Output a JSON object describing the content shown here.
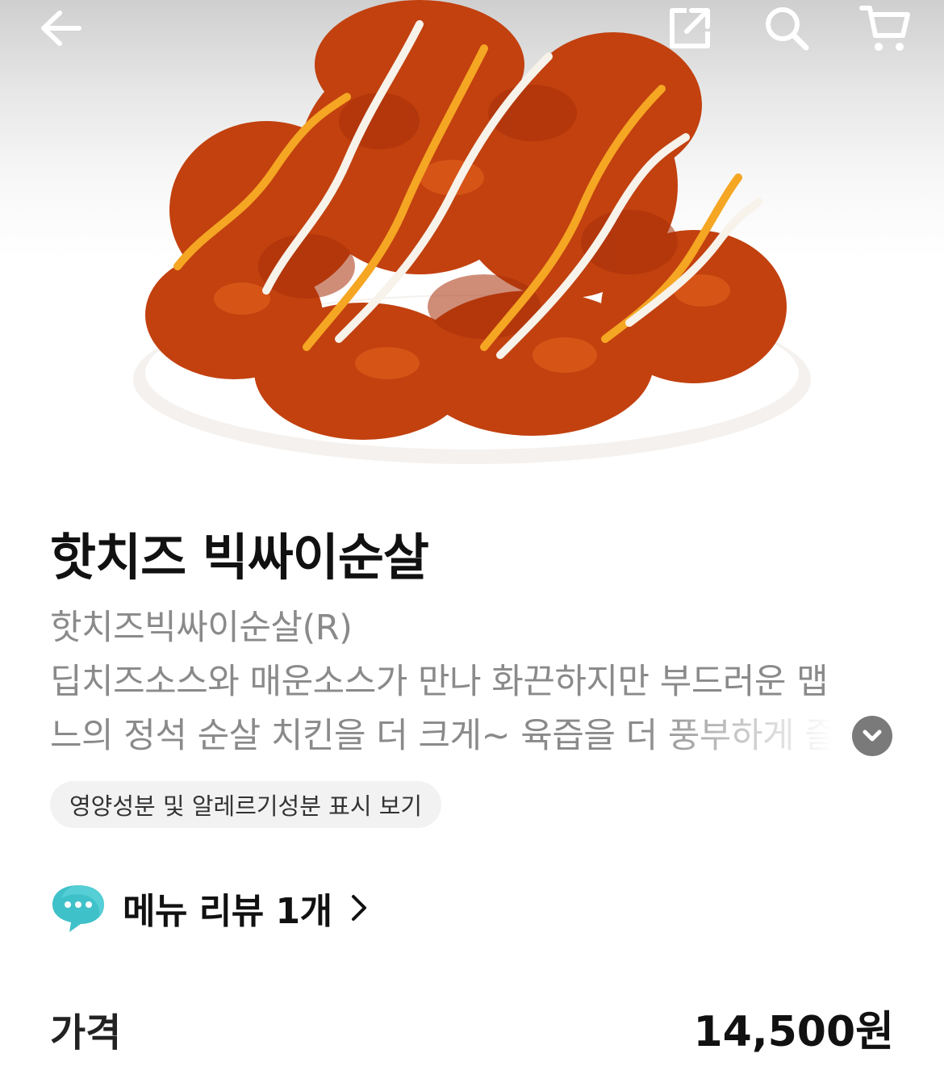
{
  "header": {
    "icons": [
      "back-arrow-icon",
      "share-icon",
      "search-icon",
      "cart-icon"
    ]
  },
  "product": {
    "name": "핫치즈 빅싸이순살",
    "description_lines": [
      "핫치즈빅싸이순살(R)",
      "딥치즈소스와 매운소스가 만나 화끈하지만 부드러운 맵",
      "느의 정석 순살 치킨을 더 크게~ 육즙을 더 풍부하게 즐"
    ],
    "nutrition_link": "영양성분 및 알레르기성분 표시 보기",
    "review_label": "메뉴 리뷰 1개",
    "price_label": "가격",
    "price_value": "14,500원"
  },
  "colors": {
    "review_icon": "#3fc1c9",
    "expand_button": "#7a7a7a",
    "chip_bg": "#f2f2f2"
  }
}
